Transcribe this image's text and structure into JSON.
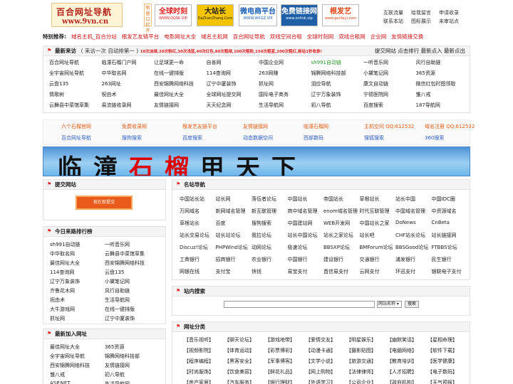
{
  "header": {
    "logo_title": "百合网址导航",
    "logo_url": "www.9vn.cn",
    "vertical_tag": "新窗口打开",
    "ads": [
      {
        "name": "全球时刻",
        "sub": "WWW.QQSK.VIP"
      },
      {
        "name": "大站长",
        "sub": "DaZhanZhang.Com"
      },
      {
        "name": "微电商平台",
        "sub": "WWW.WXGZ.VIP"
      },
      {
        "name": "免费链接网",
        "sub": "www.onlink.vip"
      },
      {
        "name": "根发艺",
        "sub": "www.genfayi.com"
      }
    ],
    "links": [
      [
        "互联流量",
        "给我留言",
        "申请收录"
      ],
      [
        "联系本站",
        "图标展示",
        "未审站点"
      ]
    ]
  },
  "recommend": {
    "label": "特别推荐:",
    "links": [
      "域名主机_百合分站",
      "根发艺友链平台",
      "电影网址大全",
      "域名主机网",
      "百合网址导航",
      "双线空间合租",
      "全球时刻网",
      "双线合租网",
      "企业网",
      "友情链接交换"
    ]
  },
  "latest": {
    "title": "最新来访",
    "note": "( 来访一次 自动排第一 )",
    "promo": "10次淡绿,20次粉红,30次浅蓝,40次红色,80次粗绿,100次粗粉,150次粗蓝,200次粗红,新站1秒收录!",
    "right_links": [
      "提交网站",
      "点击排行",
      "最新点入",
      "最新点出"
    ],
    "rows": [
      [
        "百合网址导航",
        "临潼石榴门户网",
        "让足球更一命",
        "自善网",
        "中国企业网",
        "sh991自动链",
        "一听音乐网",
        "风行自助链"
      ],
      [
        "全宇宙网址导航",
        "中华取名网",
        "在线一键排版",
        "114查询网",
        "263网赚",
        "锦腾网络科技部",
        "小黛笔记网",
        "365资源"
      ],
      [
        "云盘135",
        "263网址",
        "西安锦腾网络科技",
        "辽宁中厦装饰",
        "抓址网",
        "泪应导航",
        "康文自动链",
        "微信红包时图领取"
      ],
      [
        "情歌树",
        "祝由术",
        "最佳网址大全",
        "全球网址提交网",
        "国际电子商务",
        "辽宁万象装饰",
        "宁德医院网",
        "雏八戒"
      ],
      [
        "云舞县中菜馆草集",
        "易流链收录网",
        "友情链接网",
        "天天纪念网",
        "生活导航网",
        "初八导航",
        "百度搜索",
        "187导航网"
      ]
    ]
  },
  "mid": {
    "row1": [
      "六个石榴官网",
      "免费收录网",
      "根发艺友链平台",
      "友情链接网",
      "临潼石榴网",
      "主机空间 QQ:612532",
      "域名注册 QQ:612532"
    ],
    "row2": [
      "百合网址导航",
      "搜狗搜索",
      "百度搜索",
      "动态数据空间",
      "西部数码",
      "搜狐搜索",
      "360搜索"
    ]
  },
  "banner": {
    "chars1": "临潼",
    "chars2": "石榴",
    "chars3": "甲天下"
  },
  "left": {
    "submit": {
      "title": "提交网站",
      "button": "现在就提交"
    },
    "ranking": {
      "title": "今日来路排行榜",
      "items": [
        [
          "sh991自动链",
          "一听音乐网"
        ],
        [
          "中华取名网",
          "云舞县中菜馆草集"
        ],
        [
          "最佳网址大全",
          "西安锦腾网络科技"
        ],
        [
          "114查询网",
          "云盘135"
        ],
        [
          "辽宁万象装饰",
          "小黛笔记网"
        ],
        [
          "齐鲁花木网",
          "风行自助链"
        ],
        [
          "祝由术",
          "生活导航网"
        ],
        [
          "大牛游戏网",
          "在线一键排版"
        ],
        [
          "抓址网",
          "辽宁中厦装饰"
        ]
      ]
    },
    "newest": {
      "title": "最新加入网址",
      "items": [
        [
          "最佳网址大全",
          "365资源"
        ],
        [
          "全宇宙网址导航",
          "锦腾网络科技部"
        ],
        [
          "西安锦腾网络科技",
          "友情链接网"
        ],
        [
          "雏八戒",
          "初八导航"
        ],
        [
          "ASP.NET",
          "生活导航网"
        ]
      ]
    }
  },
  "right": {
    "famous": {
      "title": "名站导航",
      "rows": [
        [
          "中国站长站",
          "站长网",
          "落伍者论坛",
          "中国站长",
          "帝国站长",
          "草根站长",
          "站长中国",
          "中国IDC圈"
        ],
        [
          "万网域名",
          "新网域名管理",
          "新互联管理",
          "商中域名管理",
          "enom域名管理",
          "时代互联管理",
          "中国域名管理",
          "中资源域名"
        ],
        [
          "草根站长",
          "百度",
          "搜狗搜索",
          "中国建站网",
          "WEB开发网",
          "中国站长之家",
          "DoNews",
          "CnBeta"
        ],
        [
          "站长交易论坛",
          "站长站论坛",
          "我拉论坛",
          "站长中国论坛",
          "站长之家论坛",
          "站长吧",
          "CHF站长论坛",
          "站长链接网"
        ],
        [
          "Discuz!论坛",
          "PHPWind论坛",
          "动网论坛",
          "极速论坛",
          "BBSXP论坛",
          "BMForum论坛",
          "BBSGood论坛",
          "FTBBS论坛"
        ],
        [
          "工商银行",
          "招商银行",
          "农业银行",
          "中国银行",
          "建设银行",
          "交通银行",
          "浦发银行",
          "民生银行"
        ],
        [
          "网银在线",
          "支付宝",
          "快钱",
          "易宝支付",
          "首信易支付",
          "云网支付",
          "环迅支付",
          "银联电子支付"
        ]
      ]
    },
    "search": {
      "title": "站内搜索",
      "placeholder": "",
      "select": "网站名称",
      "button": "搜索"
    },
    "categories": {
      "title": "网址分类",
      "rows": [
        [
          "【音乐视听】",
          "【聊天论坛】",
          "【游戏地带】",
          "【爱情交友】",
          "【明星娱乐】",
          "【幽默笑话】",
          "【星相命理】"
        ],
        [
          "【视频影院】",
          "【体育运动】",
          "【彩票博彩】",
          "【动漫卡通】",
          "【摄影贴图】",
          "【电脑网络】",
          "【软件下载】"
        ],
        [
          "【程序编程】",
          "【黑客安全】",
          "【军事博客】",
          "【文学小说】",
          "【旅游交通】",
          "【教育培训】",
          "【医学健康】"
        ],
        [
          "【时尚服饰】",
          "【饮食美容】",
          "【鲜花礼品】",
          "【网上购物】",
          "【法律律师】",
          "【人才招聘】",
          "【电子数码】"
        ],
        [
          "【房产家居】",
          "【汽车服务】",
          "【银行理财】",
          "【外语学习】",
          "【公司企业】",
          "【政府机构】",
          "【天气预报】"
        ]
      ]
    }
  }
}
